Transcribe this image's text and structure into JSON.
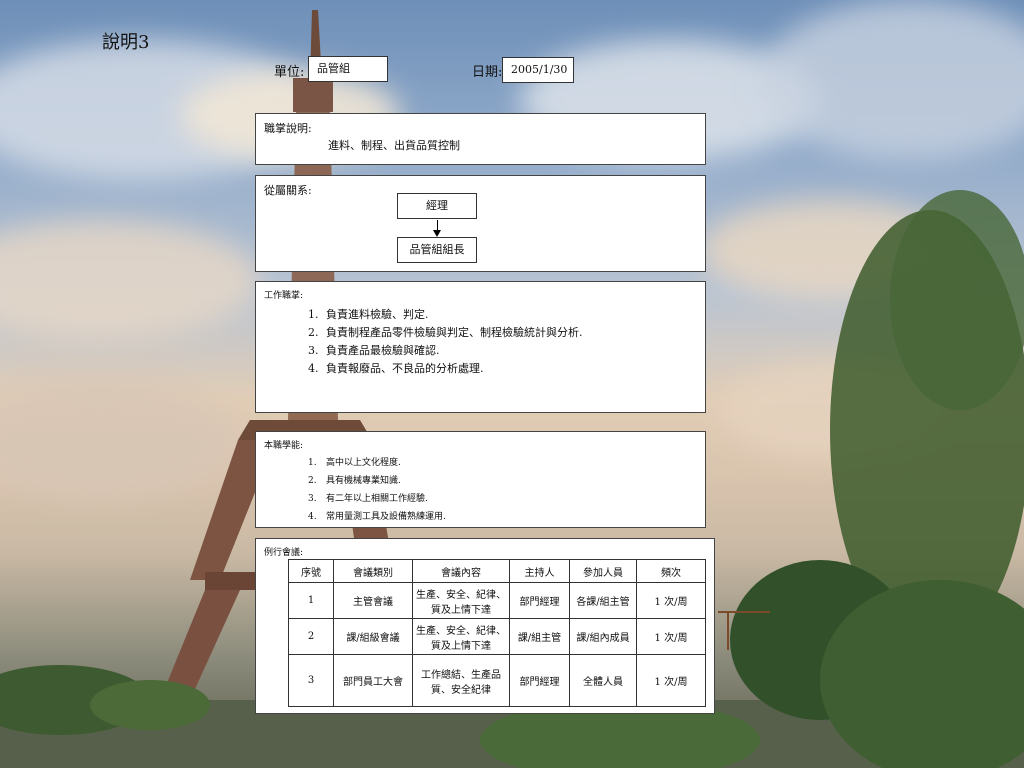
{
  "page_title": "說明3",
  "unit": {
    "label": "單位:",
    "value": "品管組"
  },
  "date": {
    "label": "日期:",
    "value": "2005/1/30"
  },
  "responsibility": {
    "heading": "職掌說明:",
    "text": "進料、制程、出貨品質控制"
  },
  "reporting": {
    "heading": "從屬關系:",
    "superior": "經理",
    "subordinate": "品管組組長"
  },
  "duties": {
    "heading": "工作職掌:",
    "items": [
      {
        "num": "1.",
        "text": "負責進料檢驗、判定."
      },
      {
        "num": "2.",
        "text": "負責制程產品零件檢驗與判定、制程檢驗統計與分析."
      },
      {
        "num": "3.",
        "text": "負責產品最檢驗與確認."
      },
      {
        "num": "4.",
        "text": "負責報廢品、不良品的分析處理."
      }
    ]
  },
  "skills": {
    "heading": "本職學能:",
    "items": [
      {
        "num": "1.",
        "text": "高中以上文化程度."
      },
      {
        "num": "2.",
        "text": "具有機械專業知識."
      },
      {
        "num": "3.",
        "text": "有二年以上相關工作經驗."
      },
      {
        "num": "4.",
        "text": "常用量測工具及設備熟練運用."
      }
    ]
  },
  "meetings": {
    "heading": "例行會議:",
    "columns": [
      "序號",
      "會議類別",
      "會議內容",
      "主持人",
      "參加人員",
      "頻次"
    ],
    "rows": [
      [
        "1",
        "主管會議",
        "生產、安全、紀律、質及上情下達",
        "部門經理",
        "各課/組主管",
        "1 次/周"
      ],
      [
        "2",
        "課/組級會議",
        "生產、安全、紀律、質及上情下達",
        "課/組主管",
        "課/組內成員",
        "1 次/周"
      ],
      [
        "3",
        "部門員工大會",
        "工作總結、生產品質、安全紀律",
        "部門經理",
        "全體人員",
        "1 次/周"
      ]
    ]
  }
}
